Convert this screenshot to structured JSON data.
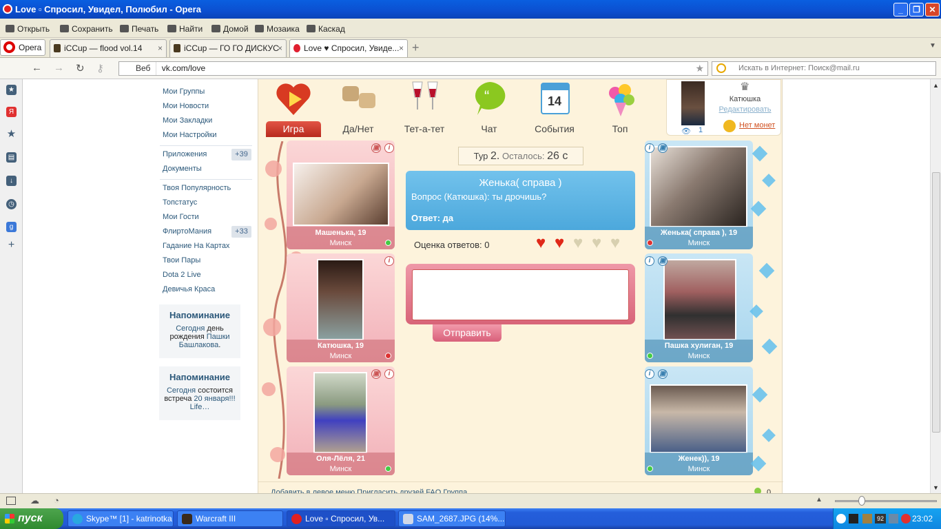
{
  "window": {
    "title": "Love ▫ Спросил, Увидел, Полюбил - Opera"
  },
  "toolbar": [
    "Открыть",
    "Сохранить",
    "Печать",
    "Найти",
    "Домой",
    "Мозаика",
    "Каскад"
  ],
  "opera": "Opera",
  "tabs": [
    "iCCup — flood vol.14",
    "iCCup — ГО ГО ДИСКУС",
    "Love ♥ Спросил, Увиде..."
  ],
  "address": {
    "web": "Веб",
    "url": "vk.com/love",
    "search_placeholder": "Искать в Интернет: Поиск@mail.ru"
  },
  "menu": {
    "items1": [
      "Мои Группы",
      "Мои Новости",
      "Мои Закладки",
      "Мои Настройки"
    ],
    "items2": [
      "Приложения",
      "Документы"
    ],
    "apps_count": "+39",
    "items3": [
      "Твоя Популярность",
      "Топстатус",
      "Мои Гости",
      "ФлиртоМания",
      "Гадание На Картах",
      "Твои Пары",
      "Dota 2 Live",
      "Девичья Краса"
    ],
    "flirt_count": "+33"
  },
  "remind1": {
    "title": "Напоминание",
    "l1": "Сегодня",
    "t1": " день рождения ",
    "l2": "Пашки Башлакова",
    "t2": "."
  },
  "remind2": {
    "title": "Напоминание",
    "l1": "Сегодня",
    "t1": " состоится встреча ",
    "l2": "20 января!!! Life…"
  },
  "appnav": [
    "Игра",
    "Да/Нет",
    "Тет-а-тет",
    "Чат",
    "События",
    "Топ"
  ],
  "calendar_day": "14",
  "profile": {
    "name": "Катюшка",
    "edit": "Редактировать",
    "views": "1",
    "coins": "Нет монет"
  },
  "left_cards": [
    {
      "name": "Машенька, 19",
      "city": "Минск",
      "online": true
    },
    {
      "name": "Катюшка, 19",
      "city": "Минск",
      "online": false
    },
    {
      "name": "Оля-Лёля, 21",
      "city": "Минск",
      "online": true
    }
  ],
  "right_cards": [
    {
      "name": "Женька( справа ), 19",
      "city": "Минск",
      "online": false
    },
    {
      "name": "Пашка хулиган, 19",
      "city": "Минск",
      "online": true
    },
    {
      "name": "Женек)), 19",
      "city": "Минск",
      "online": true
    }
  ],
  "game": {
    "tour_label": "Тур",
    "tour_num": "2.",
    "left_label": "Осталось:",
    "left_val": "26 с",
    "who": "Женька( справа )",
    "question": "Вопрос (Катюшка): ты дрочишь?",
    "answer": "Ответ: да",
    "rating": "Оценка ответов: 0",
    "hearts_filled": 2,
    "hearts_total": 5,
    "send": "Отправить"
  },
  "footer": "Добавить в левое меню   Пригласить друзей   FAQ   Группа",
  "footer_count": "0",
  "taskbar": {
    "start": "пуск",
    "tasks": [
      "Skype™ [1] - katrinotka",
      "Warcraft III",
      "Love ▫ Спросил, Ув...",
      "SAM_2687.JPG (14%..."
    ],
    "clock": "23:02"
  },
  "colors": {
    "title": "#0a55d8",
    "vk_link": "#2b587a",
    "app_bg": "#fdf3dc",
    "pink": "#f2b0b8",
    "blue": "#a8d6ee"
  }
}
